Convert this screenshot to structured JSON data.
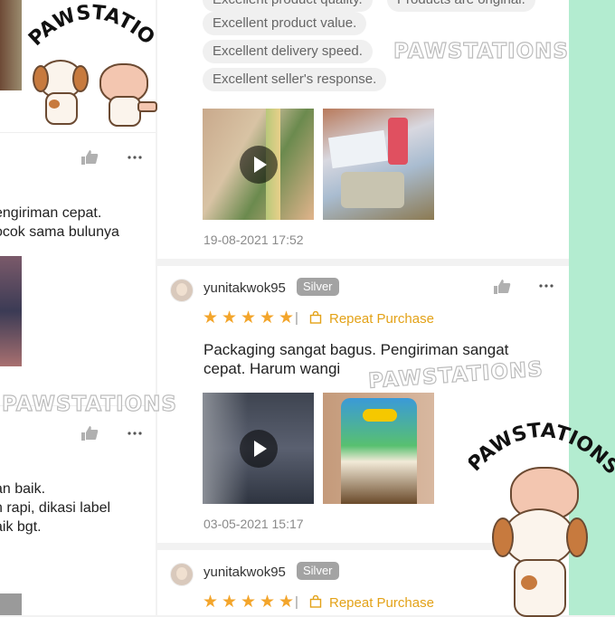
{
  "left": {
    "text_line1": "engiriman cepat.",
    "text_line2": "ocok sama bulunya",
    "text_line3": "an baik.",
    "text_line4": "n rapi, dikasi label",
    "text_line5": "aik bgt."
  },
  "review1": {
    "tags": [
      "Excellent product quality.",
      "Products are original.",
      "Excellent product value.",
      "Excellent delivery speed.",
      "Excellent seller's response."
    ],
    "date": "19-08-2021 17:52"
  },
  "review2": {
    "username": "yunitakwok95",
    "badge": "Silver",
    "rating": 5,
    "repeat_label": "Repeat Purchase",
    "text": "Packaging sangat bagus. Pengiriman sangat cepat. Harum wangi",
    "date": "03-05-2021 15:17"
  },
  "review3": {
    "username": "yunitakwok95",
    "badge": "Silver",
    "rating": 5,
    "repeat_label": "Repeat Purchase"
  },
  "watermark": "PAWSTATIONS",
  "logo_text": "PAWSTATIONS",
  "colors": {
    "star": "#f3a52b",
    "repeat": "#e3a218",
    "badge": "#a3a3a3",
    "mint": "#b3ecd0"
  }
}
